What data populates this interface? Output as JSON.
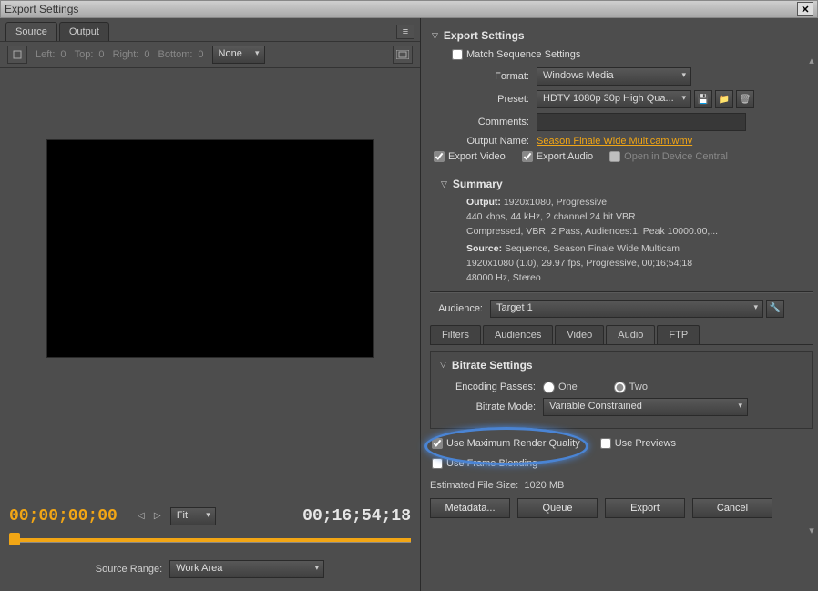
{
  "title": "Export Settings",
  "left": {
    "tabs": [
      "Source",
      "Output"
    ],
    "crop": {
      "left_label": "Left:",
      "left": "0",
      "top_label": "Top:",
      "top": "0",
      "right_label": "Right:",
      "right_val": "0",
      "bottom_label": "Bottom:",
      "bottom": "0",
      "aspect": "None"
    },
    "tc_current": "00;00;00;00",
    "tc_end": "00;16;54;18",
    "fit": "Fit",
    "source_range_label": "Source Range:",
    "source_range": "Work Area"
  },
  "right": {
    "panel_title": "Export Settings",
    "match_seq": "Match Sequence Settings",
    "format_label": "Format:",
    "format": "Windows Media",
    "preset_label": "Preset:",
    "preset": "HDTV 1080p 30p High Qua...",
    "comments_label": "Comments:",
    "comments": "",
    "output_name_label": "Output Name:",
    "output_name": "Season Finale Wide Multicam.wmv",
    "export_video": "Export Video",
    "export_audio": "Export Audio",
    "open_device": "Open in Device Central",
    "summary_title": "Summary",
    "summary_output_label": "Output:",
    "summary_output_l1": "1920x1080, Progressive",
    "summary_output_l2": "440 kbps, 44 kHz, 2 channel 24 bit VBR",
    "summary_output_l3": "Compressed, VBR, 2 Pass, Audiences:1, Peak 10000.00,...",
    "summary_source_label": "Source:",
    "summary_source_l1": "Sequence, Season Finale Wide Multicam",
    "summary_source_l2": "1920x1080 (1.0), 29.97 fps, Progressive, 00;16;54;18",
    "summary_source_l3": "48000 Hz, Stereo",
    "audience_label": "Audience:",
    "audience": "Target 1",
    "tabs": [
      "Filters",
      "Audiences",
      "Video",
      "Audio",
      "FTP"
    ],
    "active_tab": "Audio",
    "bitrate_title": "Bitrate Settings",
    "enc_passes_label": "Encoding Passes:",
    "enc_one": "One",
    "enc_two": "Two",
    "bitrate_mode_label": "Bitrate Mode:",
    "bitrate_mode": "Variable Constrained",
    "use_max": "Use Maximum Render Quality",
    "use_previews": "Use Previews",
    "use_blend": "Use Frame Blending",
    "est_size_label": "Estimated File Size:",
    "est_size": "1020 MB",
    "buttons": {
      "metadata": "Metadata...",
      "queue": "Queue",
      "export": "Export",
      "cancel": "Cancel"
    }
  }
}
